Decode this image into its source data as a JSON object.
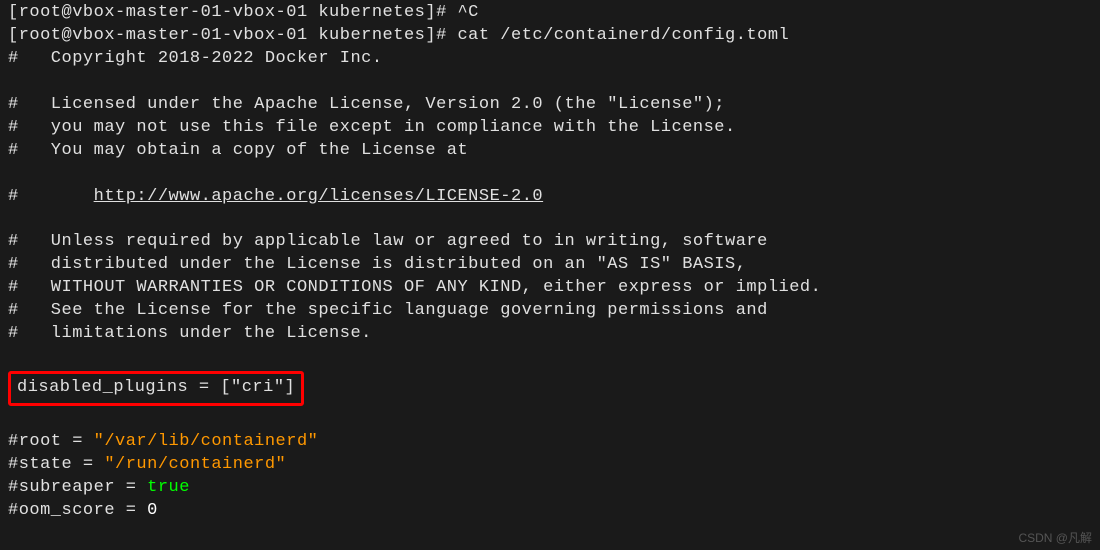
{
  "terminal": {
    "line1": "[root@vbox-master-01-vbox-01 kubernetes]# ^C",
    "line2_prompt": "[root@vbox-master-01-vbox-01 kubernetes]# ",
    "line2_cmd": "cat /etc/containerd/config.toml",
    "copyright": "#   Copyright 2018-2022 Docker Inc.",
    "blank1": "",
    "license1": "#   Licensed under the Apache License, Version 2.0 (the \"License\");",
    "license2": "#   you may not use this file except in compliance with the License.",
    "license3": "#   You may obtain a copy of the License at",
    "blank2": "",
    "url_prefix": "#       ",
    "url": "http://www.apache.org/licenses/LICENSE-2.0",
    "blank3": "",
    "license4": "#   Unless required by applicable law or agreed to in writing, software",
    "license5": "#   distributed under the License is distributed on an \"AS IS\" BASIS,",
    "license6": "#   WITHOUT WARRANTIES OR CONDITIONS OF ANY KIND, either express or implied.",
    "license7": "#   See the License for the specific language governing permissions and",
    "license8": "#   limitations under the License.",
    "blank4": "",
    "disabled_plugins": "disabled_plugins = [\"cri\"]",
    "blank5": "",
    "root_pre": "#root = ",
    "root_val": "\"/var/lib/containerd\"",
    "state_pre": "#state = ",
    "state_val": "\"/run/containerd\"",
    "subreaper_pre": "#subreaper = ",
    "subreaper_val": "true",
    "oom_pre": "#oom_score = ",
    "oom_val": "0"
  },
  "watermark": "CSDN @凡解"
}
